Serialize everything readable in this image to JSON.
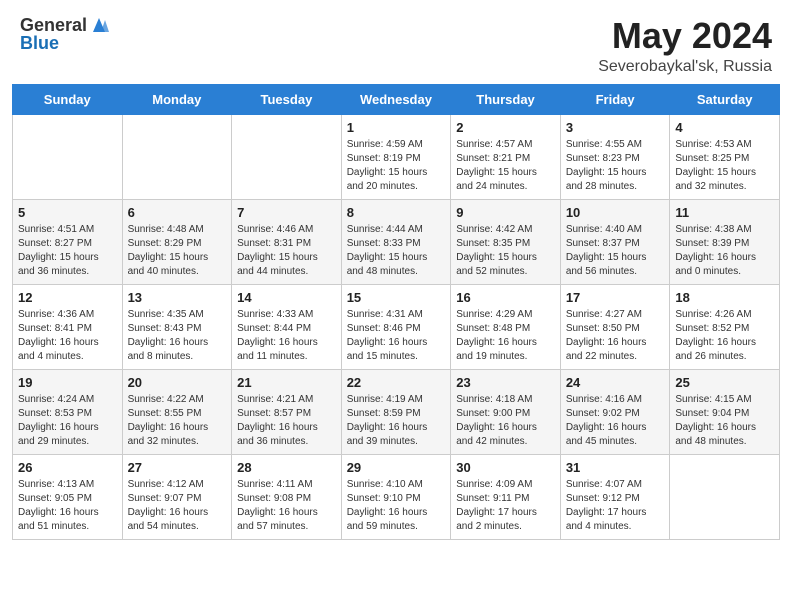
{
  "header": {
    "logo_general": "General",
    "logo_blue": "Blue",
    "month": "May 2024",
    "location": "Severobaykal'sk, Russia"
  },
  "weekdays": [
    "Sunday",
    "Monday",
    "Tuesday",
    "Wednesday",
    "Thursday",
    "Friday",
    "Saturday"
  ],
  "weeks": [
    [
      {
        "day": "",
        "info": ""
      },
      {
        "day": "",
        "info": ""
      },
      {
        "day": "",
        "info": ""
      },
      {
        "day": "1",
        "info": "Sunrise: 4:59 AM\nSunset: 8:19 PM\nDaylight: 15 hours\nand 20 minutes."
      },
      {
        "day": "2",
        "info": "Sunrise: 4:57 AM\nSunset: 8:21 PM\nDaylight: 15 hours\nand 24 minutes."
      },
      {
        "day": "3",
        "info": "Sunrise: 4:55 AM\nSunset: 8:23 PM\nDaylight: 15 hours\nand 28 minutes."
      },
      {
        "day": "4",
        "info": "Sunrise: 4:53 AM\nSunset: 8:25 PM\nDaylight: 15 hours\nand 32 minutes."
      }
    ],
    [
      {
        "day": "5",
        "info": "Sunrise: 4:51 AM\nSunset: 8:27 PM\nDaylight: 15 hours\nand 36 minutes."
      },
      {
        "day": "6",
        "info": "Sunrise: 4:48 AM\nSunset: 8:29 PM\nDaylight: 15 hours\nand 40 minutes."
      },
      {
        "day": "7",
        "info": "Sunrise: 4:46 AM\nSunset: 8:31 PM\nDaylight: 15 hours\nand 44 minutes."
      },
      {
        "day": "8",
        "info": "Sunrise: 4:44 AM\nSunset: 8:33 PM\nDaylight: 15 hours\nand 48 minutes."
      },
      {
        "day": "9",
        "info": "Sunrise: 4:42 AM\nSunset: 8:35 PM\nDaylight: 15 hours\nand 52 minutes."
      },
      {
        "day": "10",
        "info": "Sunrise: 4:40 AM\nSunset: 8:37 PM\nDaylight: 15 hours\nand 56 minutes."
      },
      {
        "day": "11",
        "info": "Sunrise: 4:38 AM\nSunset: 8:39 PM\nDaylight: 16 hours\nand 0 minutes."
      }
    ],
    [
      {
        "day": "12",
        "info": "Sunrise: 4:36 AM\nSunset: 8:41 PM\nDaylight: 16 hours\nand 4 minutes."
      },
      {
        "day": "13",
        "info": "Sunrise: 4:35 AM\nSunset: 8:43 PM\nDaylight: 16 hours\nand 8 minutes."
      },
      {
        "day": "14",
        "info": "Sunrise: 4:33 AM\nSunset: 8:44 PM\nDaylight: 16 hours\nand 11 minutes."
      },
      {
        "day": "15",
        "info": "Sunrise: 4:31 AM\nSunset: 8:46 PM\nDaylight: 16 hours\nand 15 minutes."
      },
      {
        "day": "16",
        "info": "Sunrise: 4:29 AM\nSunset: 8:48 PM\nDaylight: 16 hours\nand 19 minutes."
      },
      {
        "day": "17",
        "info": "Sunrise: 4:27 AM\nSunset: 8:50 PM\nDaylight: 16 hours\nand 22 minutes."
      },
      {
        "day": "18",
        "info": "Sunrise: 4:26 AM\nSunset: 8:52 PM\nDaylight: 16 hours\nand 26 minutes."
      }
    ],
    [
      {
        "day": "19",
        "info": "Sunrise: 4:24 AM\nSunset: 8:53 PM\nDaylight: 16 hours\nand 29 minutes."
      },
      {
        "day": "20",
        "info": "Sunrise: 4:22 AM\nSunset: 8:55 PM\nDaylight: 16 hours\nand 32 minutes."
      },
      {
        "day": "21",
        "info": "Sunrise: 4:21 AM\nSunset: 8:57 PM\nDaylight: 16 hours\nand 36 minutes."
      },
      {
        "day": "22",
        "info": "Sunrise: 4:19 AM\nSunset: 8:59 PM\nDaylight: 16 hours\nand 39 minutes."
      },
      {
        "day": "23",
        "info": "Sunrise: 4:18 AM\nSunset: 9:00 PM\nDaylight: 16 hours\nand 42 minutes."
      },
      {
        "day": "24",
        "info": "Sunrise: 4:16 AM\nSunset: 9:02 PM\nDaylight: 16 hours\nand 45 minutes."
      },
      {
        "day": "25",
        "info": "Sunrise: 4:15 AM\nSunset: 9:04 PM\nDaylight: 16 hours\nand 48 minutes."
      }
    ],
    [
      {
        "day": "26",
        "info": "Sunrise: 4:13 AM\nSunset: 9:05 PM\nDaylight: 16 hours\nand 51 minutes."
      },
      {
        "day": "27",
        "info": "Sunrise: 4:12 AM\nSunset: 9:07 PM\nDaylight: 16 hours\nand 54 minutes."
      },
      {
        "day": "28",
        "info": "Sunrise: 4:11 AM\nSunset: 9:08 PM\nDaylight: 16 hours\nand 57 minutes."
      },
      {
        "day": "29",
        "info": "Sunrise: 4:10 AM\nSunset: 9:10 PM\nDaylight: 16 hours\nand 59 minutes."
      },
      {
        "day": "30",
        "info": "Sunrise: 4:09 AM\nSunset: 9:11 PM\nDaylight: 17 hours\nand 2 minutes."
      },
      {
        "day": "31",
        "info": "Sunrise: 4:07 AM\nSunset: 9:12 PM\nDaylight: 17 hours\nand 4 minutes."
      },
      {
        "day": "",
        "info": ""
      }
    ]
  ]
}
